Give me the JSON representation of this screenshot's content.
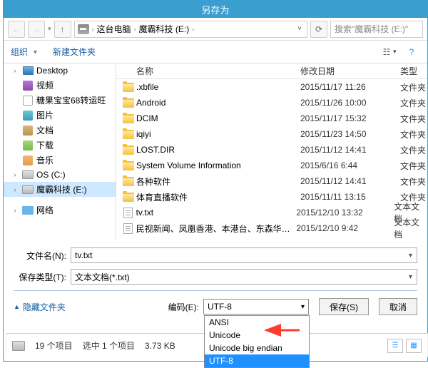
{
  "title": "另存为",
  "nav": {
    "pc": "这台电脑",
    "drive": "魔霸科技 (E:)"
  },
  "search_placeholder": "搜索\"魔霸科技 (E:)\"",
  "toolbar": {
    "org": "组织",
    "newfolder": "新建文件夹"
  },
  "sidebar": {
    "items": [
      {
        "label": "Desktop",
        "icon": "desktop"
      },
      {
        "label": "视频",
        "icon": "video"
      },
      {
        "label": "糖果宝宝68转运旺",
        "icon": "convert"
      },
      {
        "label": "图片",
        "icon": "pic"
      },
      {
        "label": "文档",
        "icon": "doc"
      },
      {
        "label": "下载",
        "icon": "dl"
      },
      {
        "label": "音乐",
        "icon": "music"
      },
      {
        "label": "OS (C:)",
        "icon": "drive"
      },
      {
        "label": "魔霸科技 (E:)",
        "icon": "drive",
        "selected": true
      }
    ],
    "network": "网络"
  },
  "columns": {
    "name": "名称",
    "date": "修改日期",
    "type": "类型"
  },
  "files": [
    {
      "name": ".xbfile",
      "date": "2015/11/17 11:26",
      "type": "文件夹",
      "kind": "folder"
    },
    {
      "name": "Android",
      "date": "2015/11/26 10:00",
      "type": "文件夹",
      "kind": "folder"
    },
    {
      "name": "DCIM",
      "date": "2015/11/17 15:32",
      "type": "文件夹",
      "kind": "folder"
    },
    {
      "name": "iqiyi",
      "date": "2015/11/23 14:50",
      "type": "文件夹",
      "kind": "folder"
    },
    {
      "name": "LOST.DIR",
      "date": "2015/11/12 14:41",
      "type": "文件夹",
      "kind": "folder"
    },
    {
      "name": "System Volume Information",
      "date": "2015/6/16 6:44",
      "type": "文件夹",
      "kind": "folder"
    },
    {
      "name": "各种软件",
      "date": "2015/11/12 14:41",
      "type": "文件夹",
      "kind": "folder"
    },
    {
      "name": "体育直播软件",
      "date": "2015/11/11 13:15",
      "type": "文件夹",
      "kind": "folder"
    },
    {
      "name": "tv.txt",
      "date": "2015/12/10 13:32",
      "type": "文本文档",
      "kind": "txt"
    },
    {
      "name": "民视新闻、凤凰香港、本港台、东森华视…",
      "date": "2015/12/10 9:42",
      "type": "文本文档",
      "kind": "txt"
    }
  ],
  "filename_label": "文件名(N):",
  "filename_value": "tv.txt",
  "filetype_label": "保存类型(T):",
  "filetype_value": "文本文档(*.txt)",
  "hide_folders": "隐藏文件夹",
  "encoding_label": "编码(E):",
  "encoding_value": "UTF-8",
  "encoding_options": [
    "ANSI",
    "Unicode",
    "Unicode big endian",
    "UTF-8"
  ],
  "save_btn": "保存(S)",
  "cancel_btn": "取消",
  "status": {
    "items": "19 个项目",
    "selected": "选中 1 个项目",
    "size": "3.73 KB"
  }
}
